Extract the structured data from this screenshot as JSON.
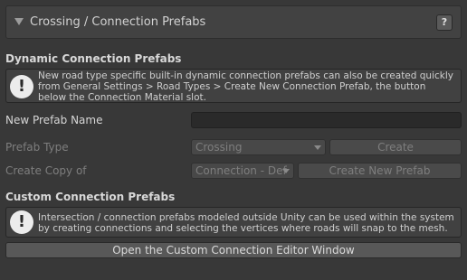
{
  "foldout": {
    "title": "Crossing / Connection Prefabs",
    "help_label": "?"
  },
  "dynamic": {
    "title": "Dynamic Connection Prefabs",
    "info_icon": "!",
    "help_text": "New road type specific built-in dynamic connection prefabs can also be created quickly from General Settings > Road Types > Create New Connection Prefab, the button below the Connection Material slot."
  },
  "new_prefab": {
    "name_label": "New Prefab Name",
    "name_value": "",
    "type_label": "Prefab Type",
    "type_selected": "Crossing",
    "create_label": "Create",
    "copy_label": "Create Copy of",
    "copy_selected": "Connection - Def",
    "create_new_label": "Create New Prefab"
  },
  "custom": {
    "title": "Custom Connection Prefabs",
    "info_icon": "!",
    "help_text": "Intersection / connection prefabs modeled outside Unity can be used within the system by creating connections and selecting the vertices where roads will snap to the mesh.",
    "open_editor_label": "Open the Custom Connection Editor Window"
  },
  "icons": {
    "foldout": "triangle-down-icon",
    "info": "exclamation-icon",
    "dropdown": "chevron-down-icon"
  }
}
